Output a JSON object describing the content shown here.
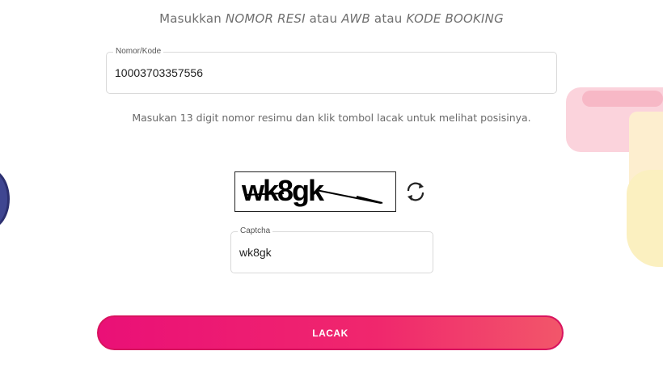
{
  "instruction": {
    "prefix": "Masukkan ",
    "term1": "NOMOR RESI",
    "join1": " atau ",
    "term2": "AWB",
    "join2": " atau ",
    "term3": "KODE BOOKING"
  },
  "resi_field": {
    "label": "Nomor/Kode",
    "value": "10003703357556"
  },
  "hint": "Masukan 13 digit nomor resimu dan klik tombol lacak untuk melihat posisinya.",
  "captcha": {
    "image_text": "wk8gk",
    "refresh_icon": "refresh-icon",
    "field_label": "Captcha",
    "field_value": "wk8gk"
  },
  "submit_label": "LACAK",
  "colors": {
    "accent_start": "#ea1077",
    "accent_end": "#f2566a",
    "text_muted": "#6f6f6f"
  }
}
